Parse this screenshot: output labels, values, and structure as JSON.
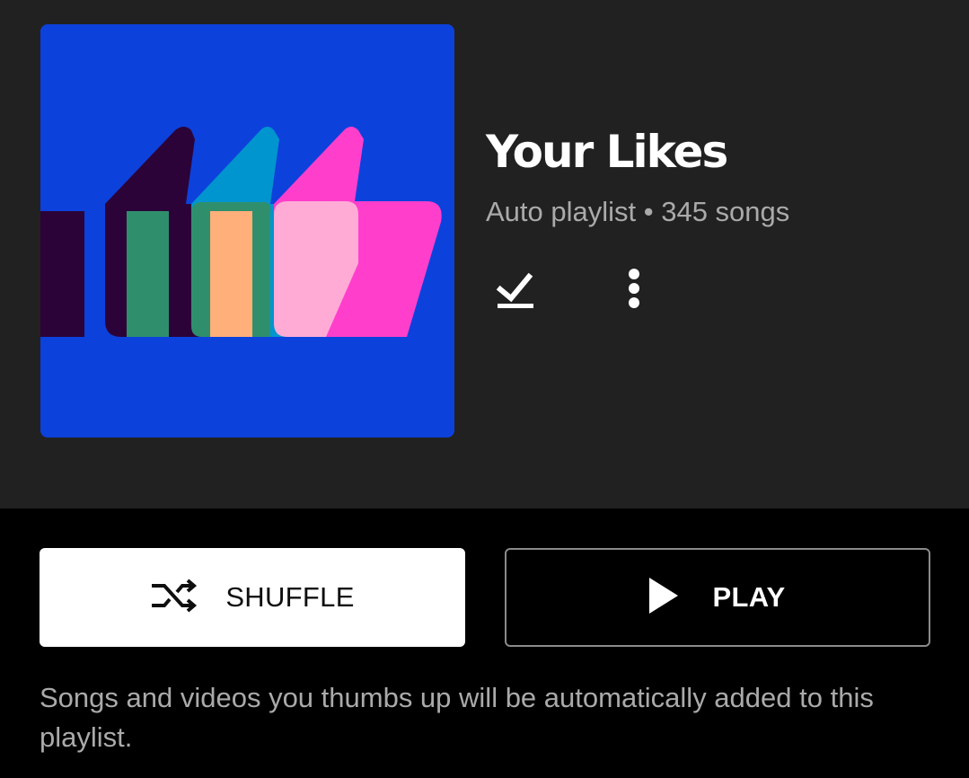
{
  "playlist": {
    "title": "Your Likes",
    "subtitle": "Auto playlist • 345 songs",
    "cover_art": {
      "semantic": "thumbs-up-cover-art",
      "background_color": "#0d41dc",
      "colors": [
        "#2c0338",
        "#0095cf",
        "#ff3ecc",
        "#2f8f6d",
        "#ffb07a",
        "#ffabd6"
      ]
    }
  },
  "actions": {
    "download_icon": "download-done-icon",
    "more_icon": "more-vert-icon"
  },
  "buttons": {
    "shuffle_label": "SHUFFLE",
    "shuffle_icon": "shuffle-icon",
    "play_label": "PLAY",
    "play_icon": "play-icon"
  },
  "description": "Songs and videos you thumbs up will be automatically added to this playlist."
}
